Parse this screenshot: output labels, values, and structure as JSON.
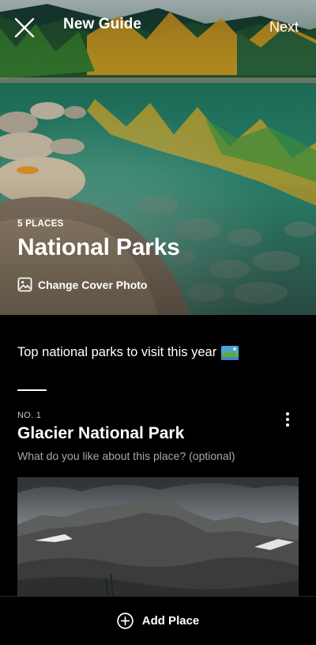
{
  "header": {
    "title": "New Guide",
    "next_label": "Next",
    "close_icon": "close-icon"
  },
  "cover": {
    "places_count": "5 PLACES",
    "title": "National Parks",
    "change_cover_label": "Change Cover Photo",
    "change_cover_icon": "image-icon"
  },
  "guide": {
    "description": "Top national parks to visit this year",
    "description_emoji": "national-park-emoji"
  },
  "places": [
    {
      "number": "NO. 1",
      "name": "Glacier National Park",
      "note_placeholder": "What do you like about this place? (optional)",
      "more_icon": "more-vertical-icon"
    }
  ],
  "footer": {
    "add_place_label": "Add Place",
    "add_place_icon": "add-circle-icon"
  }
}
